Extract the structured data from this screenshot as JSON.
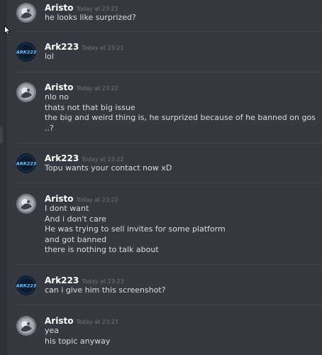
{
  "messages": [
    {
      "author": "Aristo",
      "time": "Today at 23:21",
      "lines": [
        "he looks like surprized?"
      ]
    },
    {
      "author": "Ark223",
      "time": "Today at 23:21",
      "lines": [
        "lol"
      ]
    },
    {
      "author": "Aristo",
      "time": "Today at 23:22",
      "lines": [
        "nlo no",
        "thats not that big issue",
        "the big and weird thing is, he surprized because of he banned on gos",
        "..?"
      ]
    },
    {
      "author": "Ark223",
      "time": "Today at 23:22",
      "lines": [
        "Topu wants your contact now xD"
      ]
    },
    {
      "author": "Aristo",
      "time": "Today at 23:22",
      "lines": [
        "I dont want",
        "And i don't care",
        "He was trying to sell invites for some platform",
        "and got banned",
        "there is nothing to talk about"
      ]
    },
    {
      "author": "Ark223",
      "time": "Today at 23:23",
      "lines": [
        "can i give him this screenshot?"
      ]
    },
    {
      "author": "Aristo",
      "time": "Today at 23:23",
      "lines": [
        "yea",
        "his topic anyway"
      ]
    }
  ],
  "avatars": {
    "ark223_logo_text": "ARK223"
  },
  "colors": {
    "background": "#36393f",
    "author": "#ffffff",
    "timestamp": "#72767d",
    "message_text": "#dcddde",
    "divider": "#42454a"
  }
}
